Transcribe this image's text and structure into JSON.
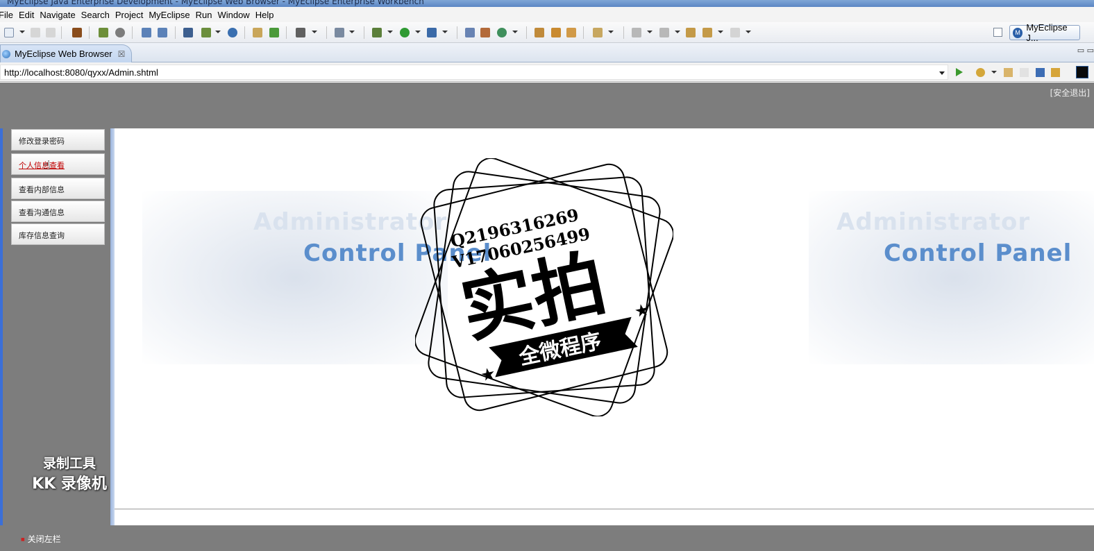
{
  "window": {
    "title": "MyEclipse Java Enterprise Development - MyEclipse Web Browser - MyEclipse Enterprise Workbench"
  },
  "menu": {
    "items": [
      "File",
      "Edit",
      "Navigate",
      "Search",
      "Project",
      "MyEclipse",
      "Run",
      "Window",
      "Help"
    ]
  },
  "toolbar": {
    "perspective_label": "MyEclipse J..."
  },
  "editor": {
    "tab_label": "MyEclipse Web Browser",
    "tab_close": "☒"
  },
  "browser": {
    "url": "http://localhost:8080/qyxx/Admin.shtml"
  },
  "page": {
    "logout": "[安全退出]",
    "nav": [
      {
        "label": "修改登录密码"
      },
      {
        "label": "个人信息查看"
      },
      {
        "label": "查看内部信息"
      },
      {
        "label": "查看沟通信息"
      },
      {
        "label": "库存信息查询"
      }
    ],
    "banner_admin": "Administrator",
    "banner_control": "Control Panel",
    "close_left": "关闭左栏"
  },
  "overlays": {
    "recorder_line1": "录制工具",
    "recorder_line2": "KK 录像机",
    "stamp_q": "Q2196316269",
    "stamp_v": "V17060256499",
    "stamp_main": "实拍",
    "stamp_ribbon": "全微程序"
  },
  "colors": {
    "header_gray": "#7d7d7d",
    "banner_blue": "#5b8ecc",
    "active_link": "#c00000"
  }
}
